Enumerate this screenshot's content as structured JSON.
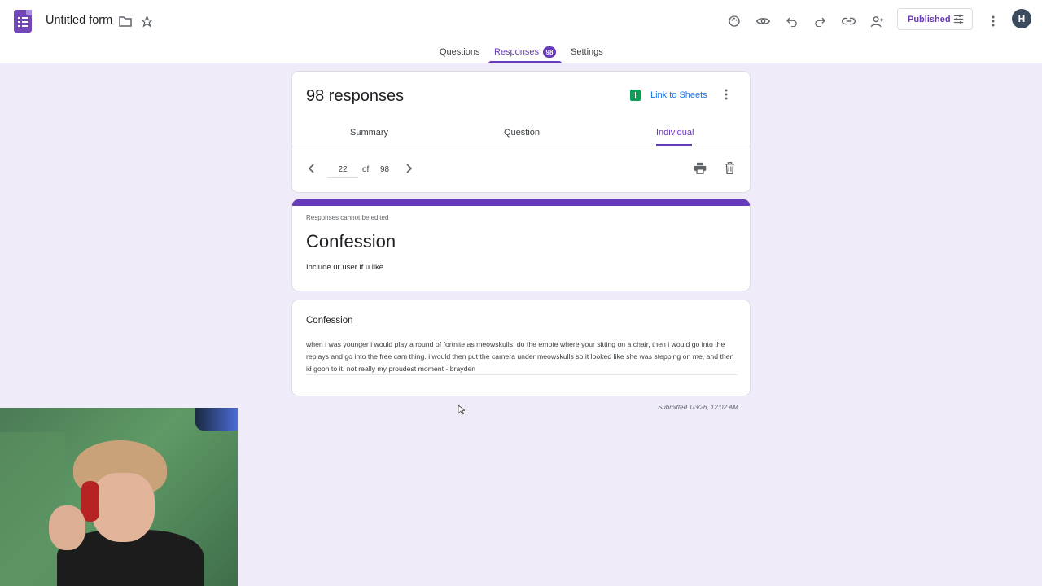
{
  "header": {
    "title": "Untitled form",
    "published_label": "Published",
    "avatar_letter": "H"
  },
  "tabs": {
    "questions": "Questions",
    "responses": "Responses",
    "responses_badge": "98",
    "settings": "Settings"
  },
  "summary_card": {
    "count_label": "98 responses",
    "link_to_sheets": "Link to Sheets",
    "sub_tabs": {
      "summary": "Summary",
      "question": "Question",
      "individual": "Individual"
    },
    "pager": {
      "current": "22",
      "of_label": "of",
      "total": "98"
    }
  },
  "form": {
    "notice": "Responses cannot be edited",
    "title": "Confession",
    "description": "Include ur user if u like"
  },
  "question": {
    "label": "Confession",
    "answer": "when i was younger i would play a round of fortnite as meowskulls, do the emote where your sitting on a chair, then i would go into the replays and go into the free cam thing. i would then put the camera under meowskulls so it looked like she was stepping on me, and then id goon to it. not really my proudest moment - brayden"
  },
  "submitted": "Submitted 1/3/26, 12:02 AM",
  "colors": {
    "accent": "#673ab7",
    "background": "#f0ebf8",
    "sheets_green": "#0f9d58",
    "link_blue": "#1a73e8"
  }
}
